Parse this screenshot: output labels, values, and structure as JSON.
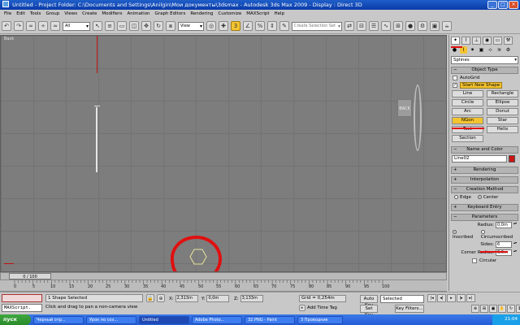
{
  "window": {
    "title": "Untitled    - Project Folder: C:\\Documents and Settings\\Anilgin\\Мои документы\\3dsmax    - Autodesk 3ds Max  2009    - Display : Direct 3D"
  },
  "menu": {
    "items": [
      "File",
      "Edit",
      "Tools",
      "Group",
      "Views",
      "Create",
      "Modifiers",
      "Animation",
      "Graph Editors",
      "Rendering",
      "Customize",
      "MAXScript",
      "Help"
    ]
  },
  "toolbar": {
    "filter_value": "All",
    "refcoord_value": "View",
    "selection_set_placeholder": "Create Selection Set"
  },
  "viewport": {
    "label": "Back",
    "viewcube_label": "BACK"
  },
  "command_panel": {
    "category_value": "Splines",
    "object_type_title": "Object Type",
    "autogrid_label": "AutoGrid",
    "start_new_shape_label": "Start New Shape",
    "buttons": [
      "Line",
      "Rectangle",
      "Circle",
      "Ellipse",
      "Arc",
      "Donut",
      "NGon",
      "Star",
      "Text",
      "Helix",
      "Section"
    ],
    "name_color_title": "Name and Color",
    "name_value": "Line02",
    "rendering_title": "Rendering",
    "interpolation_title": "Interpolation",
    "creation_method_title": "Creation Method",
    "creation_edge": "Edge",
    "creation_center": "Center",
    "keyboard_entry_title": "Keyboard Entry",
    "parameters_title": "Parameters",
    "radius_label": "Radius:",
    "radius_value": "0,0m",
    "inscribed_label": "Inscribed",
    "circumscribed_label": "Circumscribed",
    "sides_label": "Sides:",
    "sides_value": "6",
    "corner_radius_label": "Corner Radius:",
    "corner_radius_value": "0,0m",
    "circular_label": "Circular"
  },
  "timeline": {
    "slider_label": "0 / 100",
    "ticks": [
      "0",
      "5",
      "10",
      "15",
      "20",
      "25",
      "30",
      "35",
      "40",
      "45",
      "50",
      "55",
      "60",
      "65",
      "70",
      "75",
      "80",
      "85",
      "90",
      "95",
      "100"
    ]
  },
  "status": {
    "maxscript_label": "MAXScript.",
    "shape_selected": "1 Shape Selected",
    "prompt": "Click and drag to pan a non-camera view",
    "x_label": "X:",
    "x_value": "2,313m",
    "y_label": "Y:",
    "y_value": "0,0m",
    "z_label": "Z:",
    "z_value": "3,133m",
    "grid": "Grid = 0,254m",
    "add_time_tag": "Add Time Tag",
    "auto_key": "Auto Key",
    "selected_value": "Selected",
    "set_key": "Set Key",
    "key_filters": "Key Filters..."
  },
  "taskbar": {
    "start_label": "пуск",
    "tasks": [
      "Черный отр...",
      "Урок по соз...",
      "Untitled",
      "Adobe Photo...",
      "32.PNG - Paint",
      "3 Проводник"
    ],
    "clock": "21:04"
  },
  "colors": {
    "viewport_bg": "#7d7d7d",
    "annotation_red": "#e01010",
    "active_yellow": "#f4c430",
    "hexagon_stroke": "#e8e49a"
  }
}
